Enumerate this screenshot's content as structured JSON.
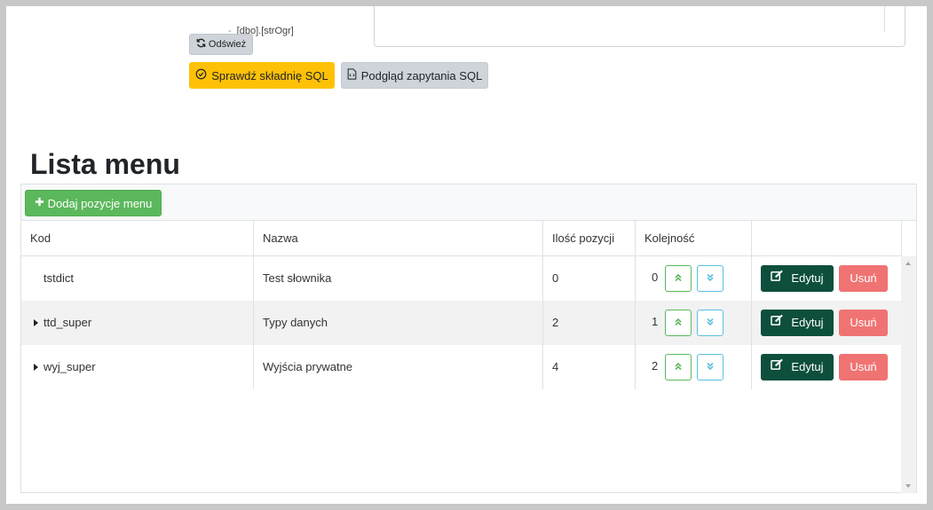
{
  "top": {
    "tree_item_text": "[dbo].[strOgr]",
    "refresh_label": "Odśwież",
    "check_sql_label": "Sprawdź składnię SQL",
    "preview_sql_label": "Podgląd zapytania SQL"
  },
  "page_title": "Lista menu",
  "toolbar": {
    "add_label": "Dodaj pozycje menu"
  },
  "table": {
    "columns": [
      "Kod",
      "Nazwa",
      "Ilość pozycji",
      "Kolejność",
      ""
    ],
    "rows": [
      {
        "code": "tstdict",
        "name": "Test słownika",
        "count": "0",
        "order": "0",
        "expandable": false
      },
      {
        "code": "ttd_super",
        "name": "Typy danych",
        "count": "2",
        "order": "1",
        "expandable": true
      },
      {
        "code": "wyj_super",
        "name": "Wyjścia prywatne",
        "count": "4",
        "order": "2",
        "expandable": true
      }
    ],
    "edit_label": "Edytuj",
    "delete_label": "Usuń"
  },
  "colors": {
    "add_button": "#5cb85c",
    "check_button": "#ffc107",
    "edit_button": "#0d4f3c",
    "delete_button": "#f07373",
    "up_button": "#5cb85c",
    "down_button": "#5bc0de"
  },
  "icons": {
    "refresh": "refresh-icon",
    "check": "check-circle-icon",
    "preview": "file-code-icon",
    "add": "plus-icon",
    "edit": "edit-icon",
    "up": "double-chevron-up-icon",
    "down": "double-chevron-down-icon"
  }
}
